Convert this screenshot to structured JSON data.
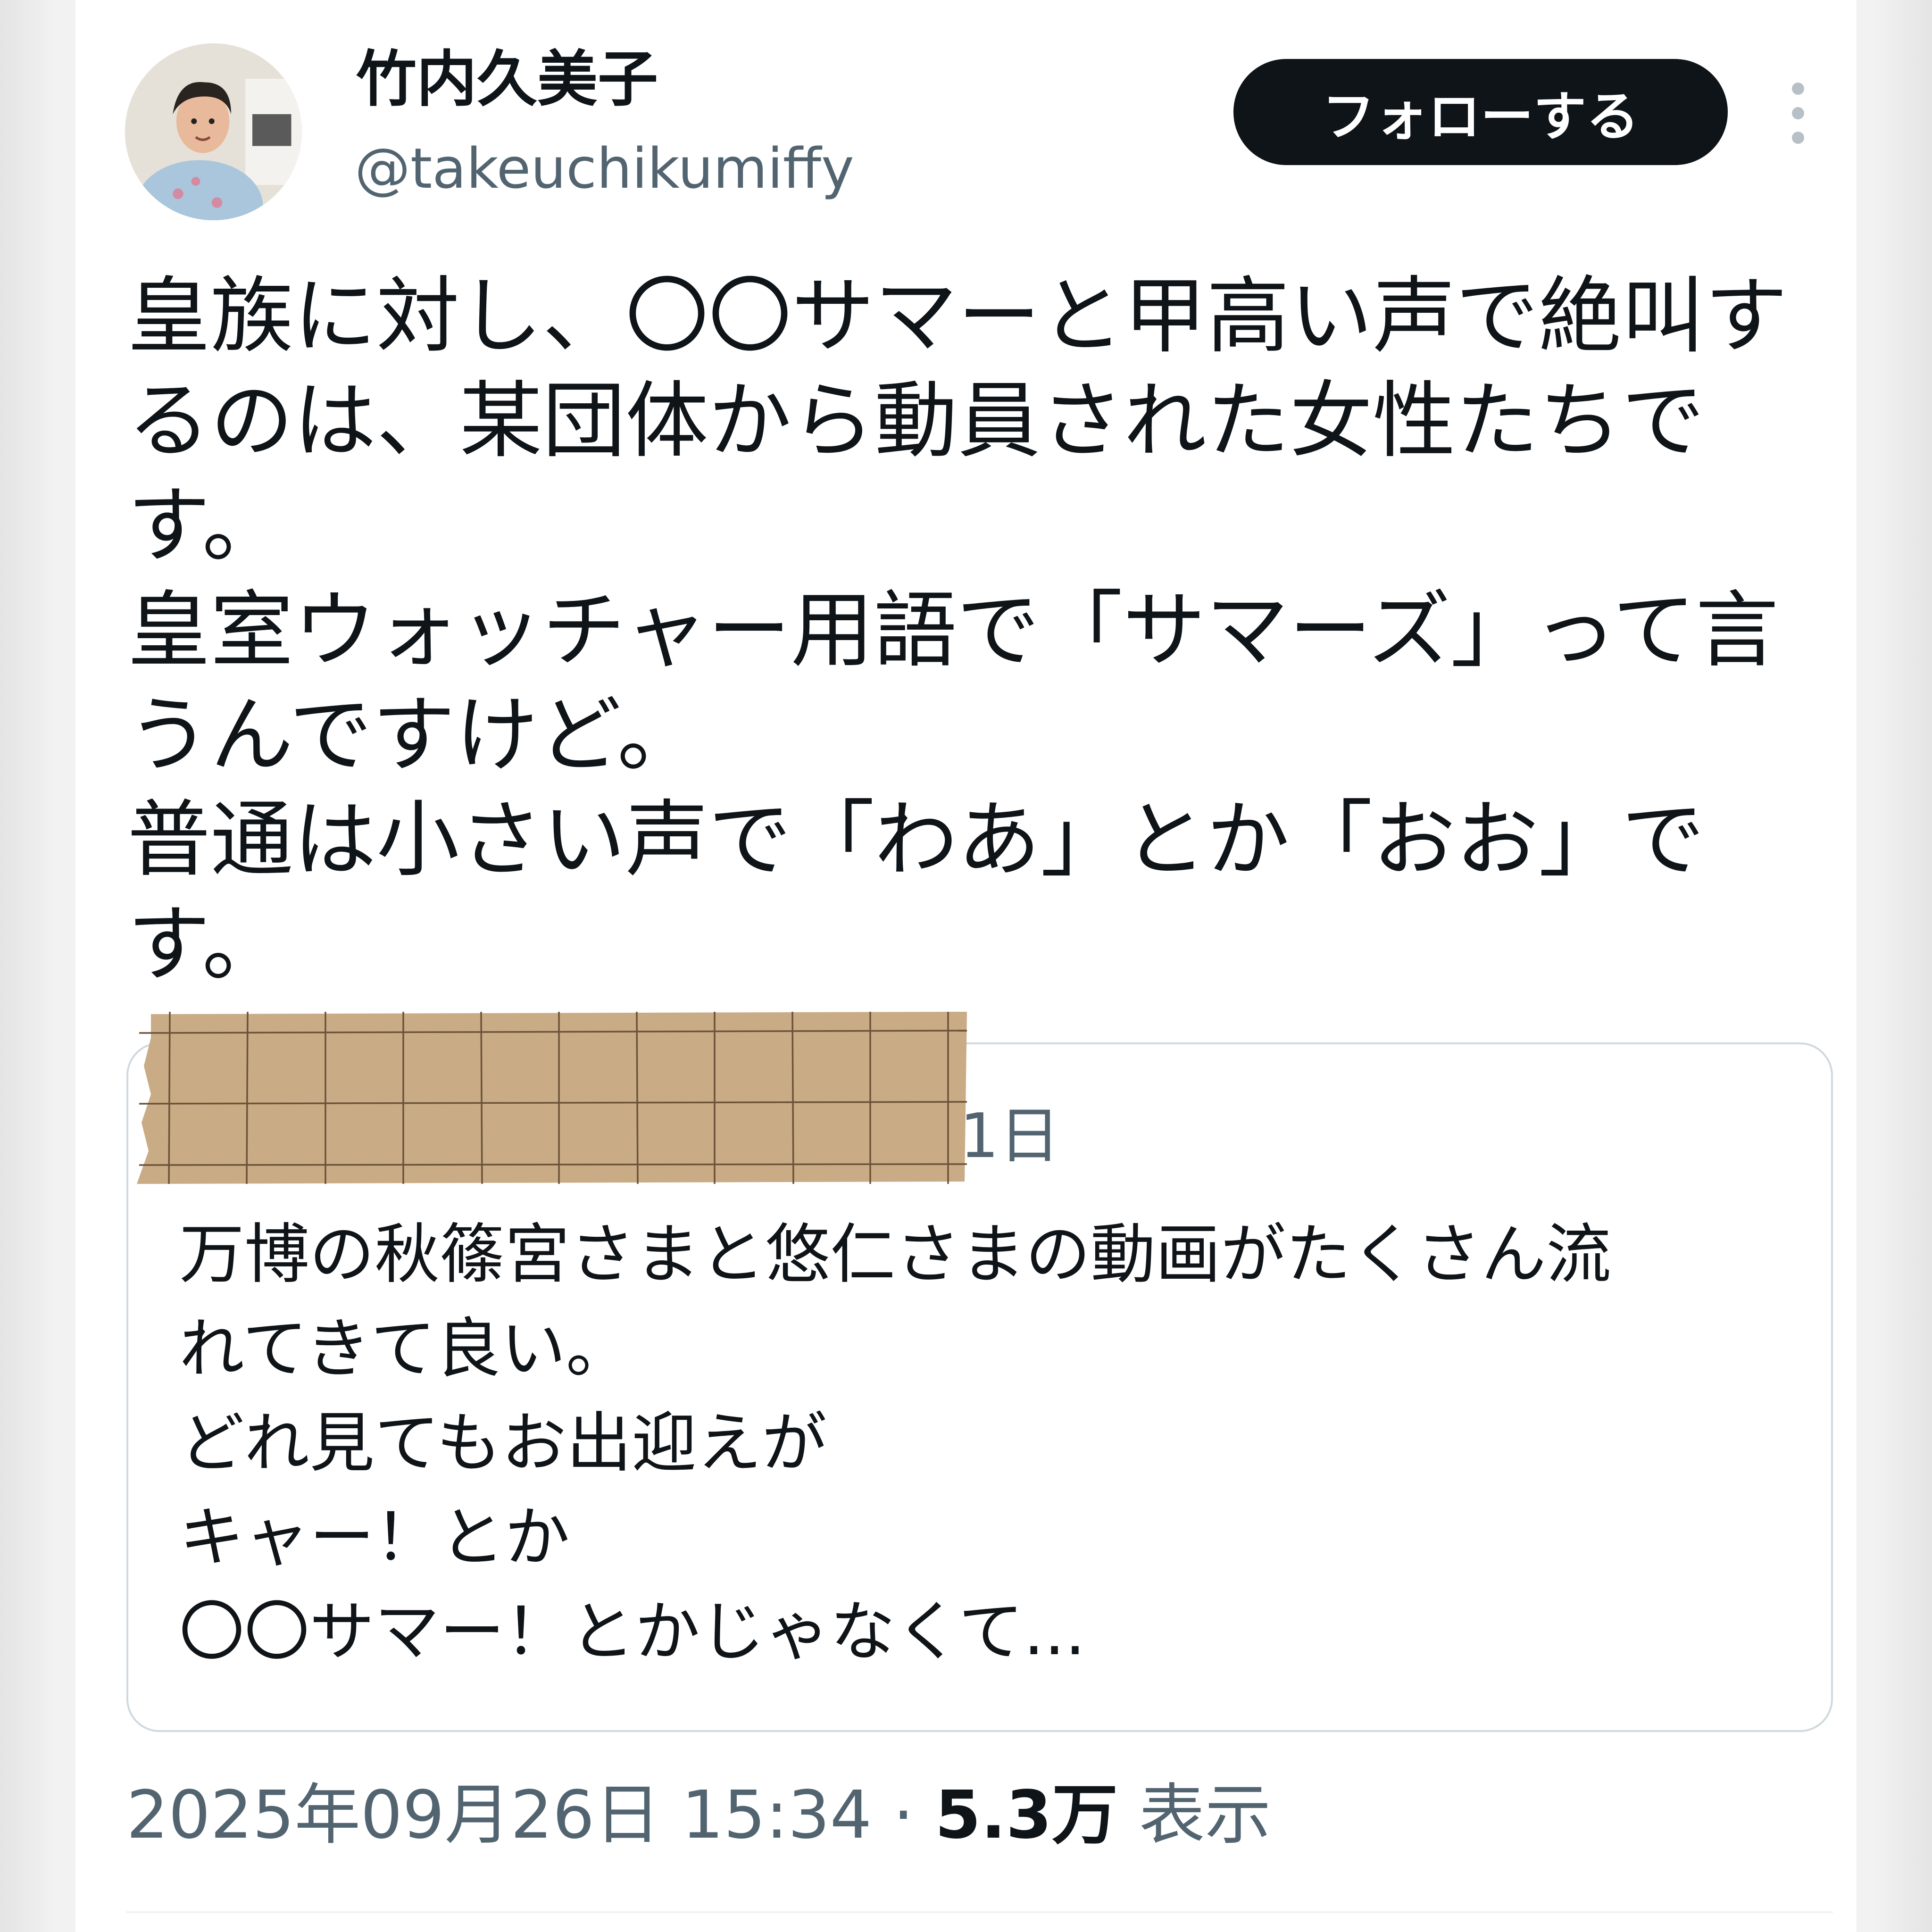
{
  "author": {
    "display_name": "竹内久美子",
    "handle": "@takeuchikumiffy"
  },
  "follow_button_label": "フォローする",
  "more_icon": "more-vertical-icon",
  "tweet": {
    "lines": [
      "皇族に対し、〇〇サマーと甲高い声で絶叫す",
      "るのは、某団体から動員された女性たちで",
      "す。",
      "皇室ウォッチャー用語で「サマーズ」って言",
      "うんですけど。",
      "普通は小さい声で「わあ」とか「おお」で",
      "す。"
    ]
  },
  "quote": {
    "time": "1日",
    "lines": [
      "万博の秋篠宮さまと悠仁さまの動画がたくさん流",
      "れてきて良い。",
      "どれ見てもお出迎えが",
      "キャー！とか",
      "〇〇サマー！とかじゃなくて..."
    ]
  },
  "meta": {
    "timestamp": "2025年09月26日 15:34",
    "separator": "·",
    "views_count": "5.3万",
    "views_label": "表示"
  },
  "colors": {
    "text_primary": "#0f1419",
    "text_secondary": "#536471",
    "border": "#cfd9de",
    "follow_bg": "#0f1419",
    "tape": "#c7ab85"
  }
}
